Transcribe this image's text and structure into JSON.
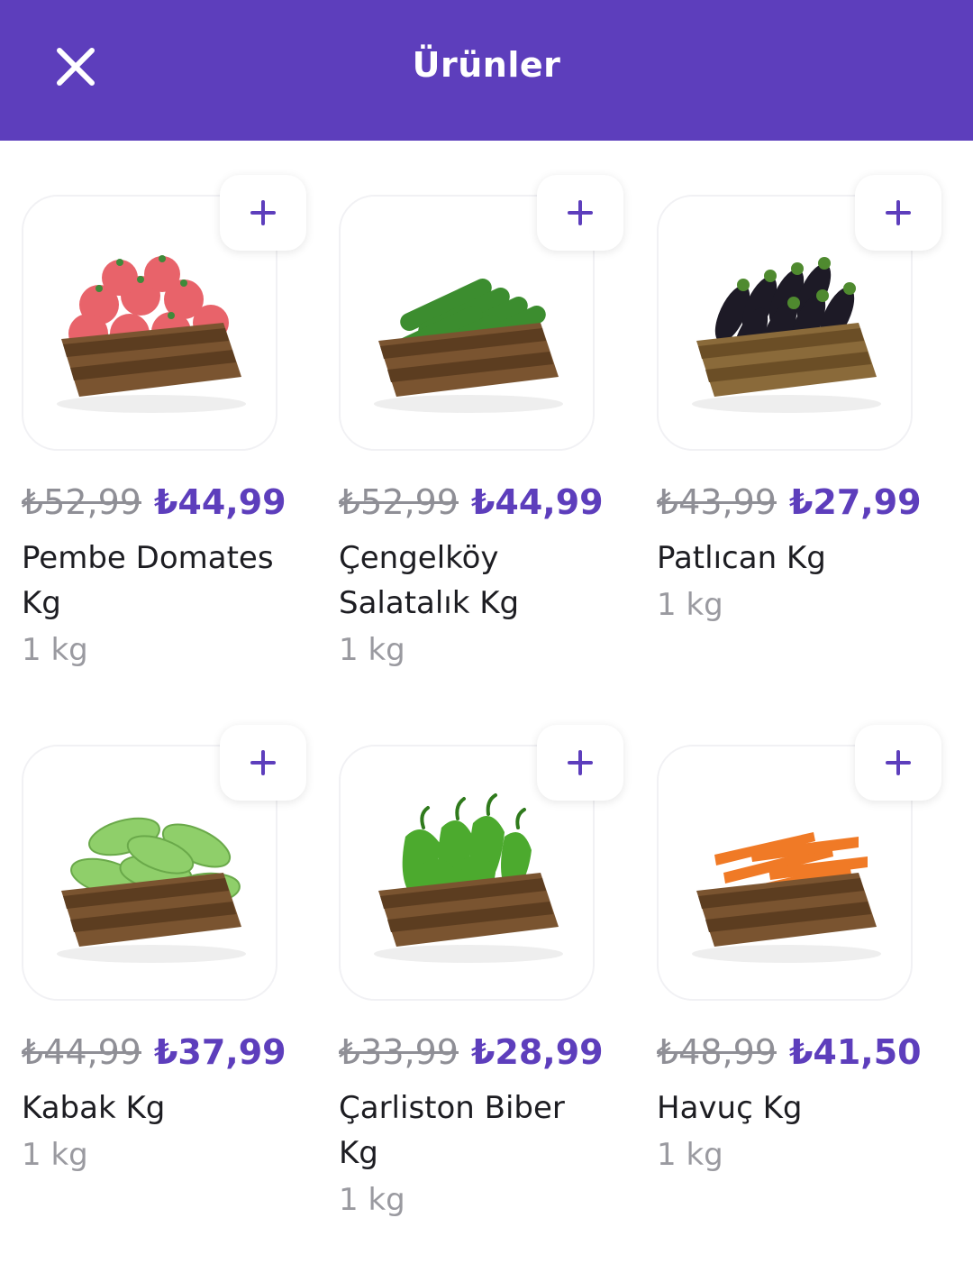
{
  "header": {
    "title": "Ürünler",
    "close_icon": "close-icon"
  },
  "colors": {
    "brand": "#5d3ebc",
    "old_price": "#8f8f96",
    "unit": "#9a9aa0"
  },
  "products": [
    {
      "old_price": "₺52,99",
      "price": "₺44,99",
      "name": "Pembe Domates Kg",
      "unit": "1 kg",
      "image": "tomatoes-crate"
    },
    {
      "old_price": "₺52,99",
      "price": "₺44,99",
      "name": "Çengelköy Salatalık Kg",
      "unit": "1 kg",
      "image": "cucumbers-crate"
    },
    {
      "old_price": "₺43,99",
      "price": "₺27,99",
      "name": "Patlıcan Kg",
      "unit": "1 kg",
      "image": "eggplants-crate"
    },
    {
      "old_price": "₺44,99",
      "price": "₺37,99",
      "name": "Kabak Kg",
      "unit": "1 kg",
      "image": "zucchini-crate"
    },
    {
      "old_price": "₺33,99",
      "price": "₺28,99",
      "name": "Çarliston Biber Kg",
      "unit": "1 kg",
      "image": "peppers-crate"
    },
    {
      "old_price": "₺48,99",
      "price": "₺41,50",
      "name": "Havuç Kg",
      "unit": "1 kg",
      "image": "carrots-crate"
    }
  ]
}
